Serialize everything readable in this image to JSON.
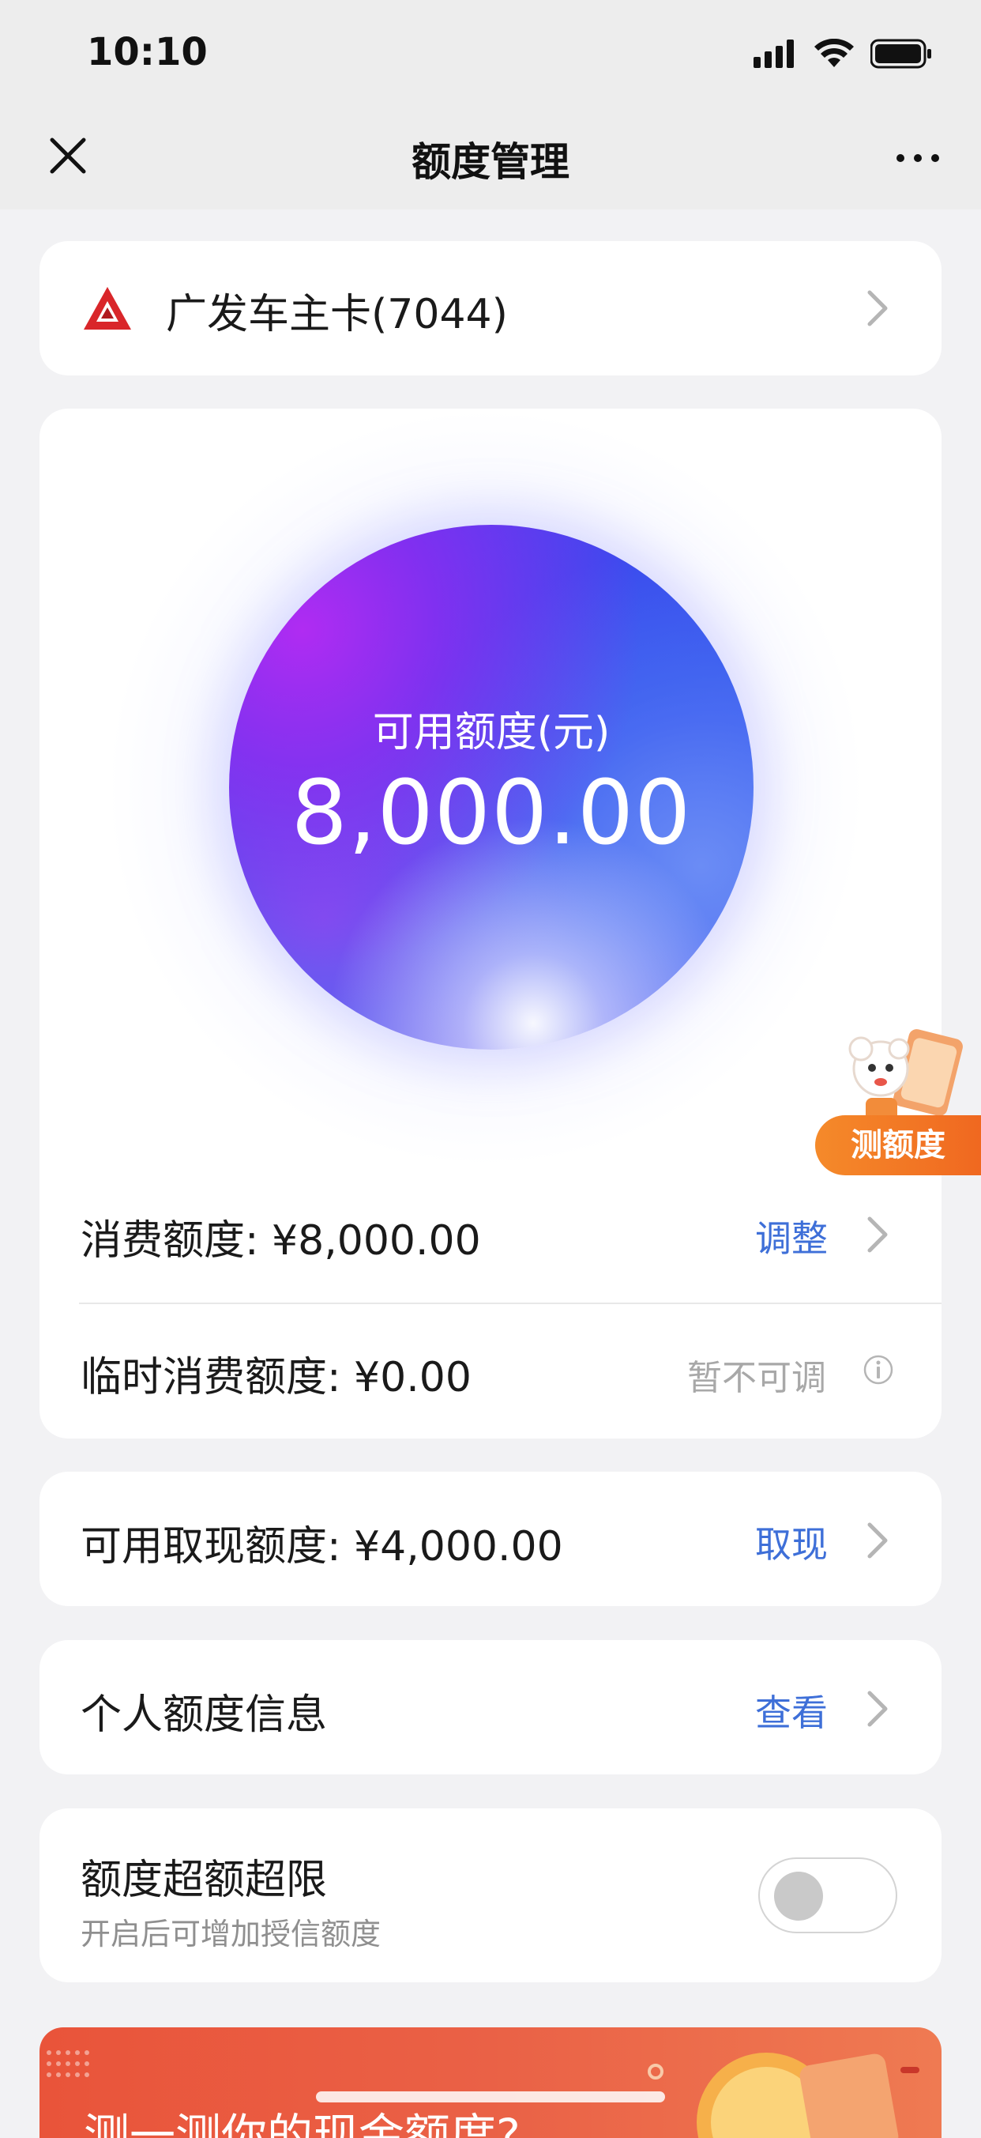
{
  "status_bar": {
    "time": "10:10"
  },
  "nav": {
    "title": "额度管理"
  },
  "card_selector": {
    "bank_name": "广发车主卡(7044)"
  },
  "credit": {
    "available_label": "可用额度(元)",
    "available_value": "8,000.00",
    "consumption_label": "消费额度: ¥8,000.00",
    "consumption_action": "调整",
    "temp_label": "临时消费额度: ¥0.00",
    "temp_status": "暂不可调",
    "badge": "测额度"
  },
  "cash": {
    "label": "可用取现额度: ¥4,000.00",
    "action": "取现"
  },
  "personal": {
    "label": "个人额度信息",
    "action": "查看"
  },
  "overlimit": {
    "title": "额度超额超限",
    "subtitle": "开启后可增加授信额度",
    "enabled": false
  },
  "banner": {
    "text": "测一测你的现金额度?"
  },
  "colors": {
    "accent": "#3e6fd8",
    "badge": "#f06820",
    "bank_logo": "#d9262a"
  }
}
